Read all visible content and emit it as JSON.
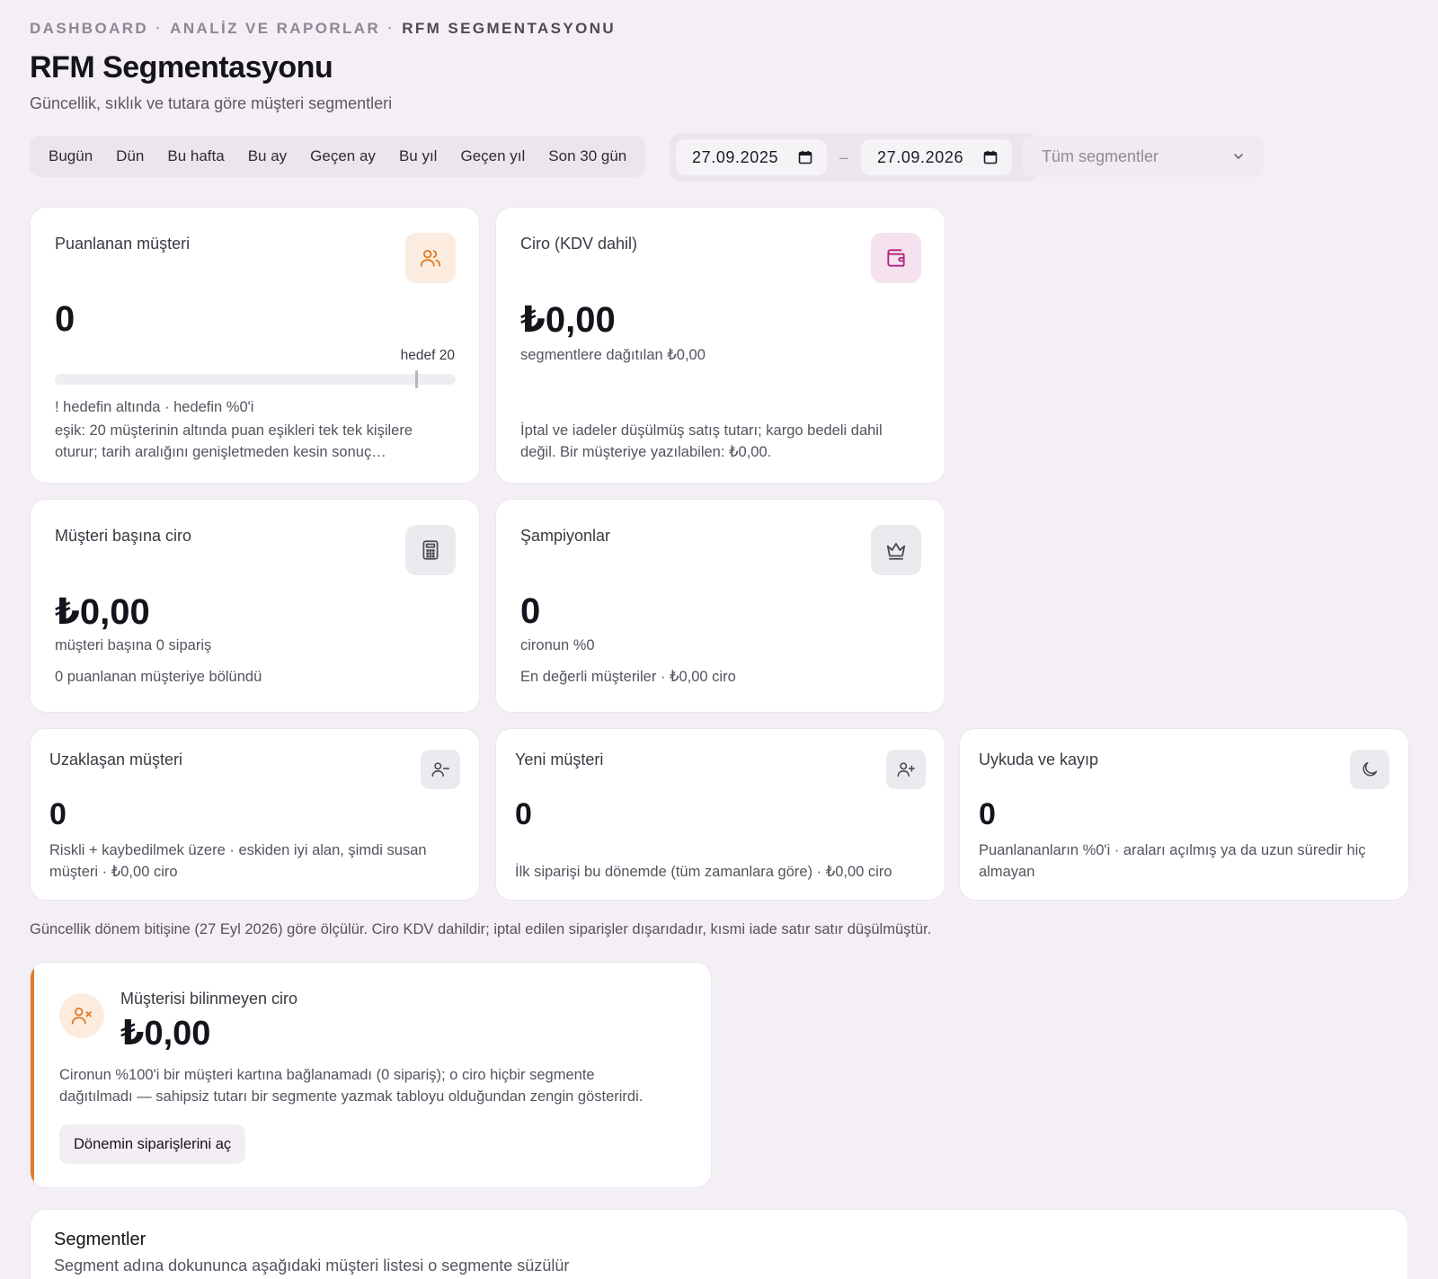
{
  "breadcrumb": {
    "items": [
      "DASHBOARD",
      "ANALİZ VE RAPORLAR",
      "RFM SEGMENTASYONU"
    ],
    "separator": "·"
  },
  "page": {
    "title": "RFM Segmentasyonu",
    "subtitle": "Güncellik, sıklık ve tutara göre müşteri segmentleri"
  },
  "quick_ranges": [
    "Bugün",
    "Dün",
    "Bu hafta",
    "Bu ay",
    "Geçen ay",
    "Bu yıl",
    "Geçen yıl",
    "Son 30 gün"
  ],
  "date_range": {
    "start": "27.09.2025",
    "end": "27.09.2026",
    "separator": "–"
  },
  "segment_filter": {
    "placeholder": "Tüm segmentler"
  },
  "cards": {
    "scored": {
      "label": "Puanlanan müşteri",
      "value": "0",
      "target_label": "hedef 20",
      "progress_fraction": 0,
      "target_fraction": 0.9,
      "status": "! hedefin altında · hedefin %0'i",
      "note_line1": "eşik: 20 müşterinin altında puan eşikleri tek tek kişilere",
      "note_line2": "oturur; tarih aralığını genişletmeden kesin sonuç…"
    },
    "revenue": {
      "label": "Ciro (KDV dahil)",
      "value": "₺0,00",
      "sub": "segmentlere dağıtılan ₺0,00",
      "note_line1": "İptal ve iadeler düşülmüş satış tutarı; kargo bedeli dahil",
      "note_line2": "değil. Bir müşteriye yazılabilen: ₺0,00."
    },
    "per_customer": {
      "label": "Müşteri başına ciro",
      "value": "₺0,00",
      "sub": "müşteri başına 0 sipariş",
      "note": "0 puanlanan müşteriye bölündü"
    },
    "champions": {
      "label": "Şampiyonlar",
      "value": "0",
      "sub": "cironun %0",
      "note": "En değerli müşteriler · ₺0,00 ciro"
    },
    "drifting": {
      "label": "Uzaklaşan müşteri",
      "value": "0",
      "note_line1": "Riskli + kaybedilmek üzere · eskiden iyi alan, şimdi susan",
      "note_line2": "müşteri · ₺0,00 ciro"
    },
    "new_customer": {
      "label": "Yeni müşteri",
      "value": "0",
      "note": "İlk siparişi bu dönemde (tüm zamanlara göre) · ₺0,00 ciro"
    },
    "dormant": {
      "label": "Uykuda ve kayıp",
      "value": "0",
      "note_line1": "Puanlananların %0'i · araları açılmış ya da uzun süredir hiç",
      "note_line2": "almayan"
    }
  },
  "footnote": "Güncellik dönem bitişine (27 Eyl 2026) göre ölçülür. Ciro KDV dahildir; iptal edilen siparişler dışarıdadır, kısmi iade satır satır düşülmüştür.",
  "unknown_revenue": {
    "label": "Müşterisi bilinmeyen ciro",
    "value": "₺0,00",
    "text_line1": "Cironun %100'i bir müşteri kartına bağlanamadı (0 sipariş); o ciro hiçbir segmente",
    "text_line2": "dağıtılmadı — sahipsiz tutarı bir segmente yazmak tabloyu olduğundan zengin gösterirdi.",
    "button": "Dönemin siparişlerini aç"
  },
  "segments": {
    "title": "Segmentler",
    "subtitle": "Segment adına dokununca aşağıdaki müşteri listesi o segmente süzülür"
  },
  "colors": {
    "background": "#f3eff5",
    "accent_orange": "#e07a24",
    "icon_pink": "#b0247a"
  },
  "icons": {
    "scored": "users-icon",
    "revenue": "wallet-icon",
    "per_customer": "calculator-icon",
    "champions": "crown-icon",
    "drifting": "user-minus-icon",
    "new_customer": "user-plus-icon",
    "dormant": "moon-icon",
    "unknown": "user-x-icon"
  }
}
